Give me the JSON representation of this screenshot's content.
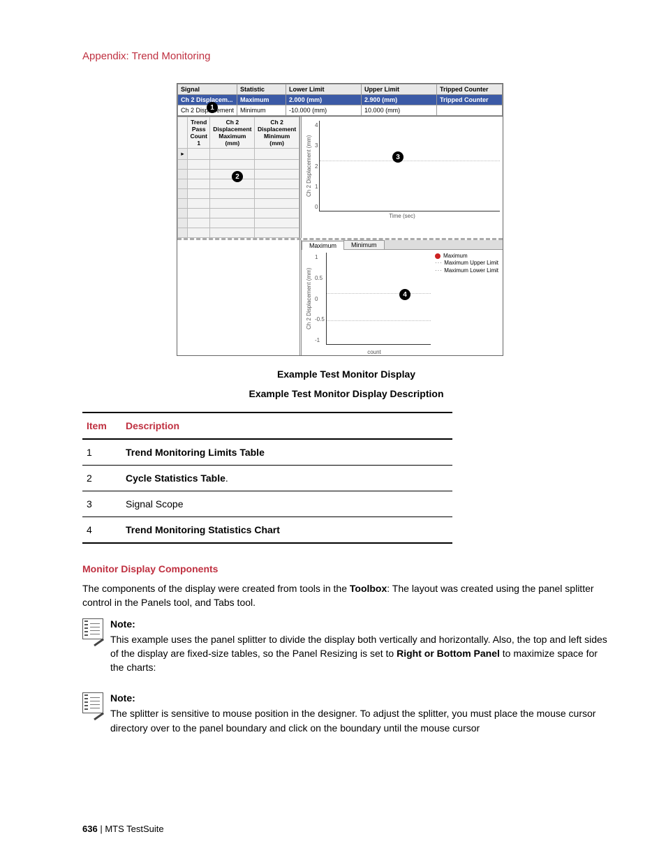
{
  "appendix_title": "Appendix: Trend Monitoring",
  "limits": {
    "headers": [
      "Signal",
      "Statistic",
      "Lower Limit",
      "Upper Limit",
      "Tripped Counter"
    ],
    "rows": [
      {
        "signal": "Ch 2 Displacem...",
        "stat": "Maximum",
        "low": "2.000 (mm)",
        "up": "2.900 (mm)",
        "trip": "Tripped Counter",
        "selected": true
      },
      {
        "signal": "Ch 2 Displacement",
        "stat": "Minimum",
        "low": "-10.000 (mm)",
        "up": "10.000 (mm)",
        "trip": "",
        "selected": false
      }
    ]
  },
  "cycle_stats": {
    "headers": [
      "Trend Pass Count 1",
      "Ch 2 Displacement Maximum (mm)",
      "Ch 2 Displacement Minimum (mm)"
    ],
    "row_indicator": "▸"
  },
  "scope": {
    "ylabel": "Ch 2 Displacement (mm)",
    "yticks": [
      "4",
      "3",
      "2",
      "1",
      "0"
    ],
    "xlabel": "Time (sec)"
  },
  "tabs": {
    "active": "Maximum",
    "other": "Minimum"
  },
  "trend": {
    "ylabel": "Ch 2 Displacement (mm)",
    "yticks": [
      "1",
      "0.5",
      "0",
      "-0.5",
      "-1"
    ],
    "xlabel": "count",
    "legend": [
      "Maximum",
      "Maximum Upper Limit",
      "Maximum Lower Limit"
    ]
  },
  "callouts": {
    "c1": "1",
    "c2": "2",
    "c3": "3",
    "c4": "4"
  },
  "caption1": "Example Test Monitor Display",
  "caption2": "Example Test Monitor Display Description",
  "desc_table": {
    "head_item": "Item",
    "head_desc": "Description",
    "rows": [
      {
        "n": "1",
        "d": "Trend Monitoring Limits Table",
        "bold": true,
        "trail": ""
      },
      {
        "n": "2",
        "d": "Cycle Statistics Table",
        "bold": true,
        "trail": "."
      },
      {
        "n": "3",
        "d": "Signal Scope",
        "bold": false,
        "trail": ""
      },
      {
        "n": "4",
        "d": "Trend Monitoring Statistics Chart",
        "bold": true,
        "trail": ""
      }
    ]
  },
  "h_components": "Monitor Display Components",
  "p_components_1": "The components of the display were created from tools in the ",
  "p_components_b": "Toolbox",
  "p_components_2": ": The layout was created using the panel splitter control in the Panels tool, and Tabs tool.",
  "note1": {
    "label": "Note:",
    "t1": "This example uses the panel splitter to divide the display both vertically and horizontally. Also, the top and left sides of the display are fixed-size tables, so the Panel Resizing is set to ",
    "b1": "Right or Bottom Panel",
    "t2": " to maximize space for the charts:"
  },
  "note2": {
    "label": "Note:",
    "t1": "The splitter is sensitive to mouse position in the designer. To adjust the splitter, you must place the mouse cursor directory over to the panel boundary and click on the boundary until the mouse cursor"
  },
  "footer": {
    "page": "636",
    "sep": " | ",
    "product": "MTS TestSuite"
  },
  "chart_data": [
    {
      "type": "line",
      "title": "Signal Scope",
      "xlabel": "Time (sec)",
      "ylabel": "Ch 2 Displacement (mm)",
      "ylim": [
        0,
        4
      ],
      "x": [],
      "values": [],
      "note": "empty plot with dotted horizontal gridline near y≈2.2"
    },
    {
      "type": "line",
      "title": "Trend Monitoring Statistics Chart (Maximum tab)",
      "xlabel": "count",
      "ylabel": "Ch 2 Displacement (mm)",
      "ylim": [
        -1,
        1
      ],
      "series": [
        {
          "name": "Maximum",
          "values": []
        },
        {
          "name": "Maximum Upper Limit",
          "values": [],
          "style": "dotted",
          "approx_constant": 0.1
        },
        {
          "name": "Maximum Lower Limit",
          "values": [],
          "style": "dotted",
          "approx_constant": -0.5
        }
      ]
    }
  ]
}
